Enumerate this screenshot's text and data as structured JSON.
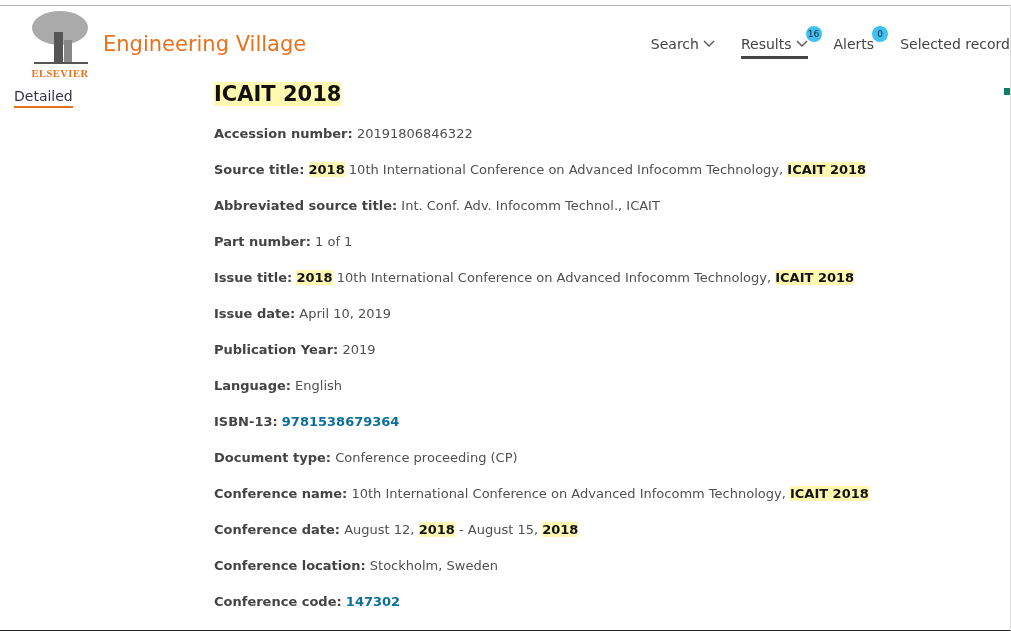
{
  "header": {
    "logo_caption": "ELSEVIER",
    "product": "Engineering Village"
  },
  "nav": [
    {
      "label": "Search",
      "dropdown": true,
      "selected": false
    },
    {
      "label": "Results",
      "dropdown": true,
      "selected": true,
      "badge": "16"
    },
    {
      "label": "Alerts",
      "dropdown": false,
      "selected": false,
      "badge": "0"
    },
    {
      "label": "Selected record",
      "dropdown": false,
      "selected": false
    }
  ],
  "side_tabs": [
    {
      "label": "Detailed",
      "selected": true
    }
  ],
  "record": {
    "title": "ICAIT 2018",
    "title_highlight": true,
    "fields": [
      {
        "label": "Accession number:",
        "value": [
          {
            "text": "20191806846322",
            "kind": "plain"
          }
        ]
      },
      {
        "label": "Source title:",
        "value": [
          {
            "text": "2018",
            "kind": "highlight"
          },
          {
            "text": "10th International Conference on Advanced Infocomm Technology,",
            "kind": "plain"
          },
          {
            "text": "ICAIT 2018",
            "kind": "highlight"
          }
        ]
      },
      {
        "label": "Abbreviated source title:",
        "value": [
          {
            "text": "Int. Conf. Adv. Infocomm Technol., ICAIT",
            "kind": "plain"
          }
        ]
      },
      {
        "label": "Part number:",
        "value": [
          {
            "text": "1 of 1",
            "kind": "plain"
          }
        ]
      },
      {
        "label": "Issue title:",
        "value": [
          {
            "text": "2018",
            "kind": "highlight"
          },
          {
            "text": "10th International Conference on Advanced Infocomm Technology,",
            "kind": "plain"
          },
          {
            "text": "ICAIT 2018",
            "kind": "highlight"
          }
        ]
      },
      {
        "label": "Issue date:",
        "value": [
          {
            "text": "April 10, 2019",
            "kind": "plain"
          }
        ]
      },
      {
        "label": "Publication Year:",
        "value": [
          {
            "text": "2019",
            "kind": "plain"
          }
        ]
      },
      {
        "label": "Language:",
        "value": [
          {
            "text": "English",
            "kind": "plain"
          }
        ]
      },
      {
        "label": "ISBN-13:",
        "value": [
          {
            "text": "9781538679364",
            "kind": "link"
          }
        ]
      },
      {
        "label": "Document type:",
        "value": [
          {
            "text": "Conference proceeding (CP)",
            "kind": "plain"
          }
        ]
      },
      {
        "label": "Conference name:",
        "value": [
          {
            "text": "10th International Conference on Advanced Infocomm Technology,",
            "kind": "plain"
          },
          {
            "text": "ICAIT 2018",
            "kind": "highlight"
          }
        ]
      },
      {
        "label": "Conference date:",
        "value": [
          {
            "text": "August 12,",
            "kind": "plain"
          },
          {
            "text": "2018",
            "kind": "highlight"
          },
          {
            "text": "- August 15,",
            "kind": "plain"
          },
          {
            "text": "2018",
            "kind": "highlight"
          }
        ]
      },
      {
        "label": "Conference location:",
        "value": [
          {
            "text": "Stockholm, Sweden",
            "kind": "plain"
          }
        ]
      },
      {
        "label": "Conference code:",
        "value": [
          {
            "text": "147302",
            "kind": "link"
          }
        ]
      }
    ]
  }
}
